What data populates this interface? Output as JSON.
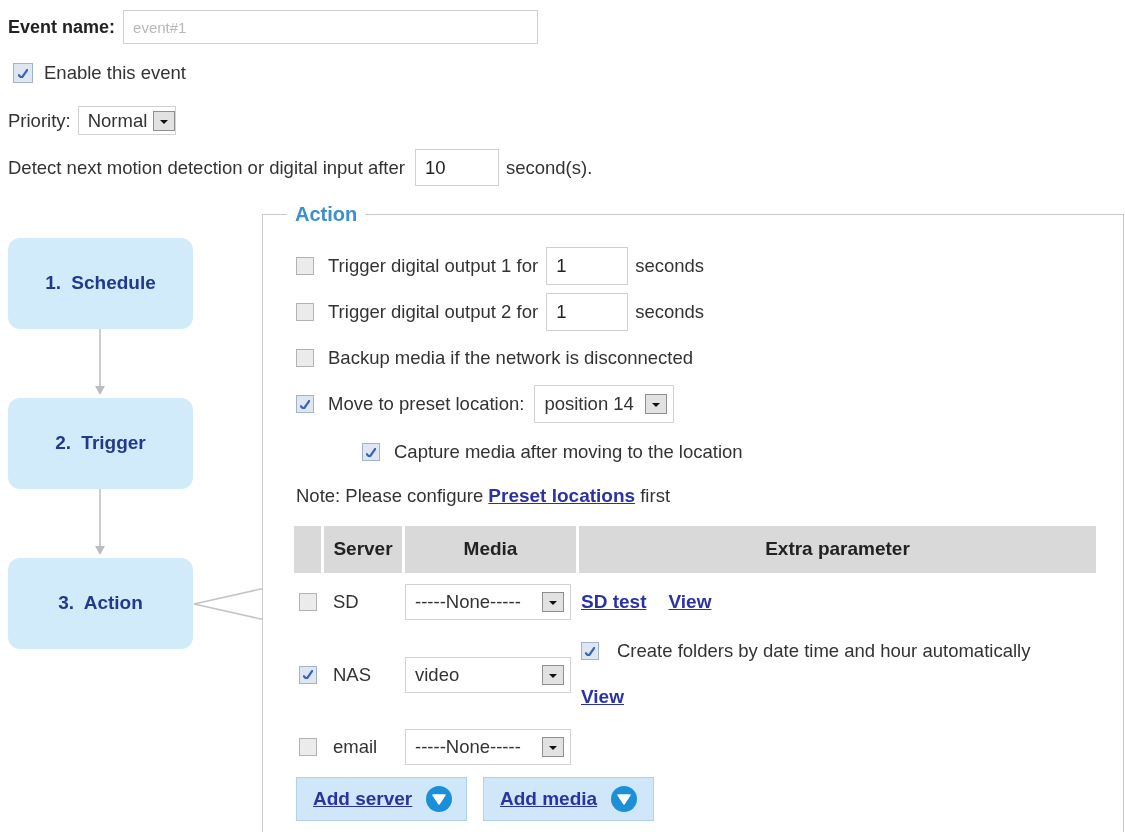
{
  "event_name": {
    "label": "Event name:",
    "placeholder": "event#1"
  },
  "enable_event": {
    "label": "Enable this event",
    "checked": true
  },
  "priority": {
    "label": "Priority:",
    "value": "Normal"
  },
  "detect_delay": {
    "label": "Detect next motion detection or digital input after",
    "value": "10",
    "unit": "second(s)."
  },
  "workflow": {
    "steps": [
      {
        "label": "1. Schedule",
        "selected": false
      },
      {
        "label": "2. Trigger",
        "selected": false
      },
      {
        "label": "3. Action",
        "selected": true
      }
    ]
  },
  "action": {
    "legend": "Action",
    "options": [
      {
        "kind": "duration",
        "label": "Trigger digital output 1 for",
        "value": "1",
        "unit": "seconds",
        "checked": false
      },
      {
        "kind": "duration",
        "label": "Trigger digital output 2 for",
        "value": "1",
        "unit": "seconds",
        "checked": false
      },
      {
        "kind": "plain",
        "label": "Backup media if the network is disconnected",
        "checked": false
      },
      {
        "kind": "select",
        "label": "Move to preset location:",
        "value": "position 14",
        "checked": true,
        "children": [
          {
            "kind": "plain",
            "label": "Capture media after moving to the location",
            "checked": true
          }
        ]
      }
    ],
    "note": {
      "text": "Note: Please configure",
      "link": "Preset locations",
      "after": "first"
    },
    "table": {
      "columns": [
        "Server",
        "Media",
        "Extra parameter"
      ],
      "rows": [
        {
          "checked": false,
          "server": "SD",
          "media": "-----None-----",
          "extra": [
            {
              "kind": "link",
              "text": "SD test"
            },
            {
              "kind": "link",
              "text": "View"
            }
          ]
        },
        {
          "checked": true,
          "server": "NAS",
          "media": "video",
          "extra": [
            {
              "kind": "checkbox",
              "label": "Create folders by date time and hour automatically",
              "checked": true
            },
            {
              "kind": "link",
              "text": "View"
            }
          ]
        },
        {
          "checked": false,
          "server": "email",
          "media": "-----None-----"
        }
      ]
    },
    "buttons": [
      {
        "label": "Add server"
      },
      {
        "label": "Add media"
      }
    ]
  }
}
